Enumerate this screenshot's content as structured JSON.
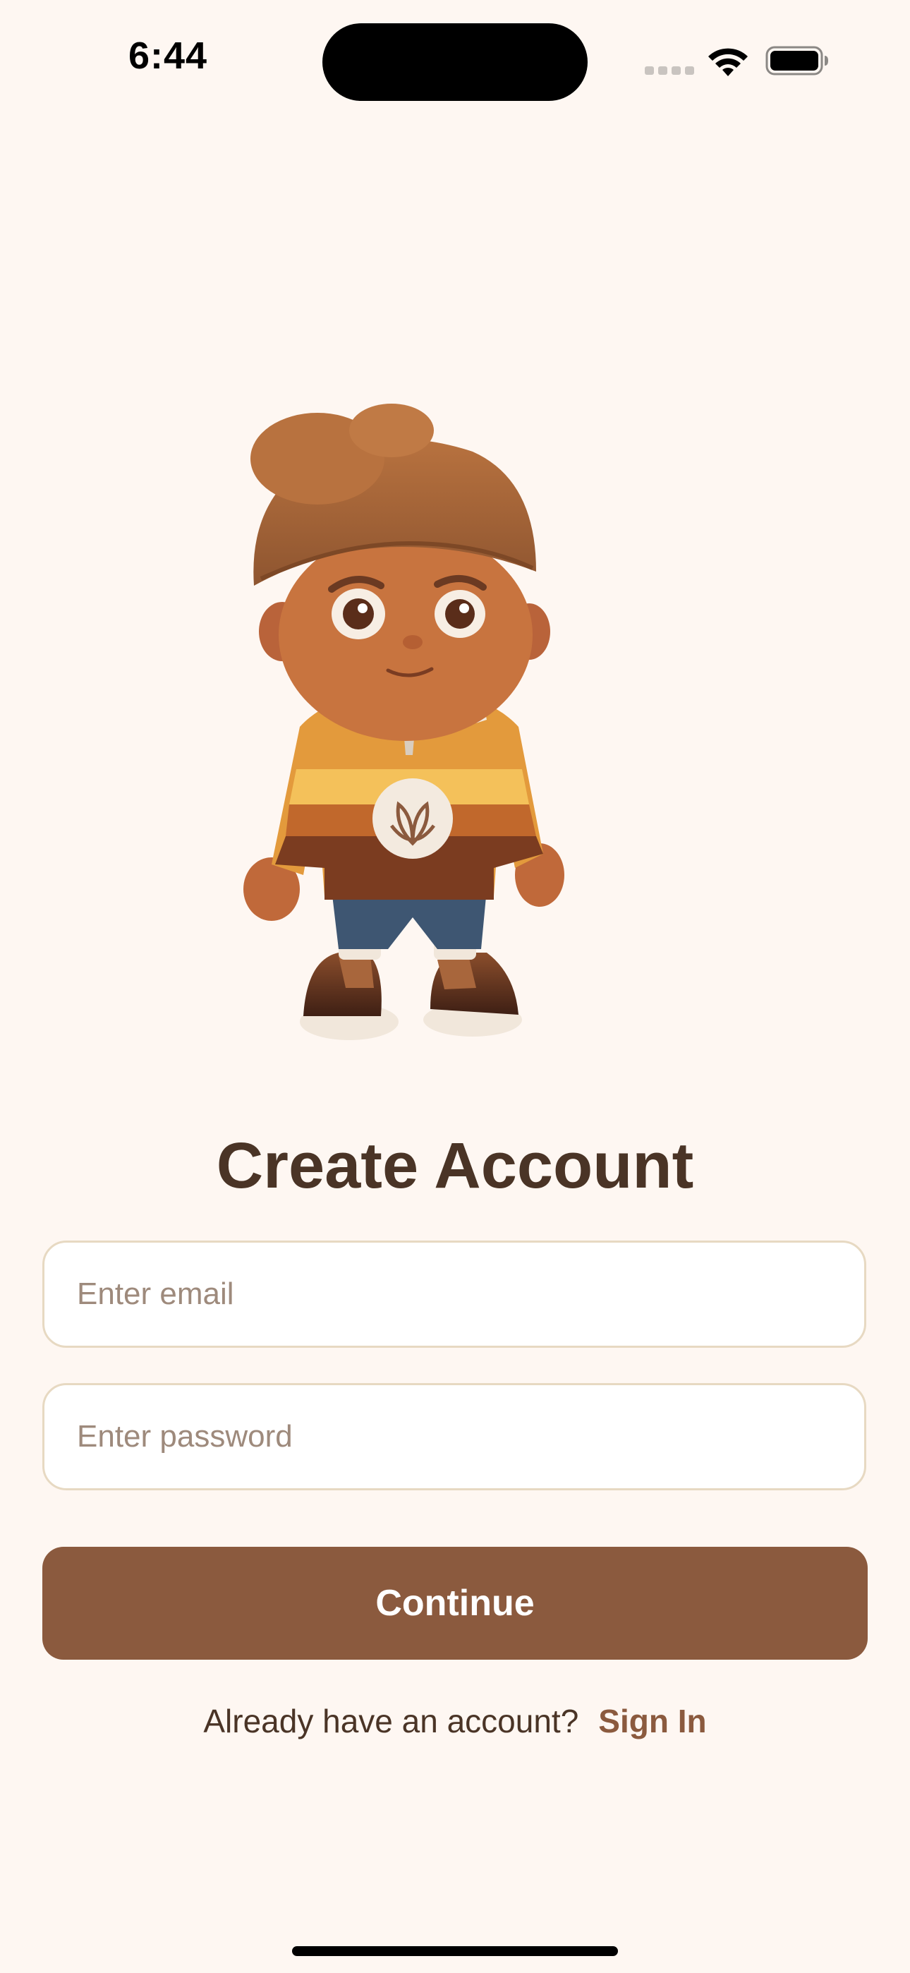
{
  "status_bar": {
    "time": "6:44"
  },
  "mascot": {
    "icon": "barista-character-illustration"
  },
  "form": {
    "title": "Create Account",
    "email_placeholder": "Enter email",
    "password_placeholder": "Enter password",
    "continue_label": "Continue"
  },
  "footer": {
    "prompt": "Already have an account?",
    "sign_in_label": "Sign In"
  },
  "colors": {
    "background": "#FEF7F2",
    "primary": "#8B5A3E",
    "title": "#4A3426",
    "field_border": "#E7D9C2"
  }
}
